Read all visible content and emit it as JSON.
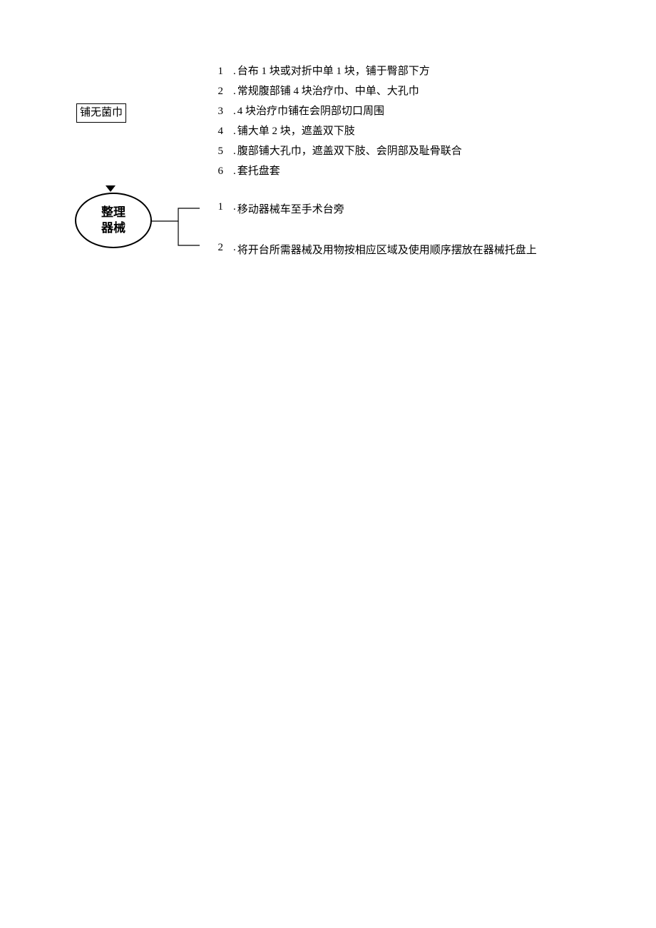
{
  "nodes": {
    "rect1": "铺无菌巾",
    "ellipse1": "整理\n器械"
  },
  "list1": [
    {
      "n": "1",
      "t": "台布 1 块或对折中单 1 块，铺于臀部下方"
    },
    {
      "n": "2",
      "t": "常规腹部铺 4 块治疗巾、中单、大孔巾"
    },
    {
      "n": "3",
      "t": "4 块治疗巾铺在会阴部切口周围"
    },
    {
      "n": "4",
      "t": "铺大单 2 块，遮盖双下肢"
    },
    {
      "n": "5",
      "t": "腹部铺大孔巾，遮盖双下肢、会阴部及耻骨联合"
    },
    {
      "n": "6",
      "t": "套托盘套"
    }
  ],
  "list2": [
    {
      "n": "1",
      "t": "移动器械车至手术台旁"
    },
    {
      "n": "2",
      "t": "将开台所需器械及用物按相应区域及使用顺序摆放在器械托盘上"
    }
  ]
}
